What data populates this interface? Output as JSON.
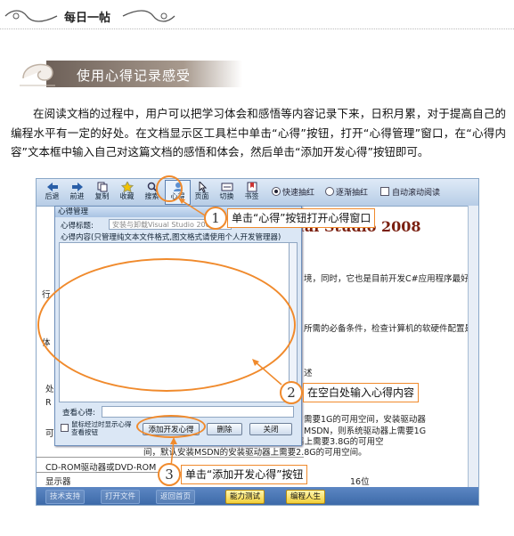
{
  "header": {
    "title": "每日一帖"
  },
  "section": {
    "title": "使用心得记录感受"
  },
  "paragraph": "在阅读文档的过程中，用户可以把学习体会和感悟等内容记录下来，日积月累，对于提高自己的编程水平有一定的好处。在文档显示区工具栏中单击“心得”按钮，打开“心得管理”窗口，在“心得内容”文本框中输入自己对这篇文档的感悟和体会，然后单击“添加开发心得”按钮即可。",
  "toolbar": {
    "buttons": [
      "后退",
      "前进",
      "复制",
      "收藏",
      "搜索",
      "心得",
      "页面",
      "切换",
      "书签"
    ],
    "options": [
      "快速抽红",
      "逐渐抽红",
      "自动滚动阅读"
    ]
  },
  "document": {
    "title_fragment": "Visual Studio 2008",
    "lines": [
      "境，同时，它也是目前开发C#应用程序最好的",
      "所需的必备条件，检查计算机的软硬件配置是",
      "述",
      "需要1G的可用空间，安装驱动器",
      "MSDN，则系统驱动器上需要1G",
      "的可用空间，完整安装MSDN的安装驱动器上需要3.8G的可用空",
      "间，默认安装MSDN的安装驱动器上需要2.8G的可用空间。",
      "CD-ROM驱动器或DVD-ROM",
      "显示器",
      "16位"
    ],
    "left_fragments": [
      "行",
      "体",
      "处",
      "R",
      "可"
    ]
  },
  "dialog": {
    "title": "心得管理",
    "title_label": "心得标题:",
    "title_value": "安装与卸载Visual Studio 2008",
    "content_label": "心得内容(只管理纯文本文件格式,图文格式请使用个人开发管理器)",
    "view_label": "查看心得:",
    "checkbox_label": "鼠标经过时显示心得查看按钮",
    "buttons": [
      "添加开发心得",
      "删除",
      "关闭"
    ]
  },
  "taskbar": [
    "技术支持",
    "打开文件",
    "返回首页",
    "能力测试",
    "编程人生"
  ],
  "callouts": [
    {
      "num": "1",
      "text": "单击“心得”按钮打开心得窗口"
    },
    {
      "num": "2",
      "text": "在空白处输入心得内容"
    },
    {
      "num": "3",
      "text": "单击“添加开发心得”按钮"
    }
  ],
  "colors": {
    "accent": "#f08a2c",
    "banner": "#8a7b6e",
    "dialog_bg": "#dbe7f5",
    "taskbar": "#4a76b6"
  }
}
